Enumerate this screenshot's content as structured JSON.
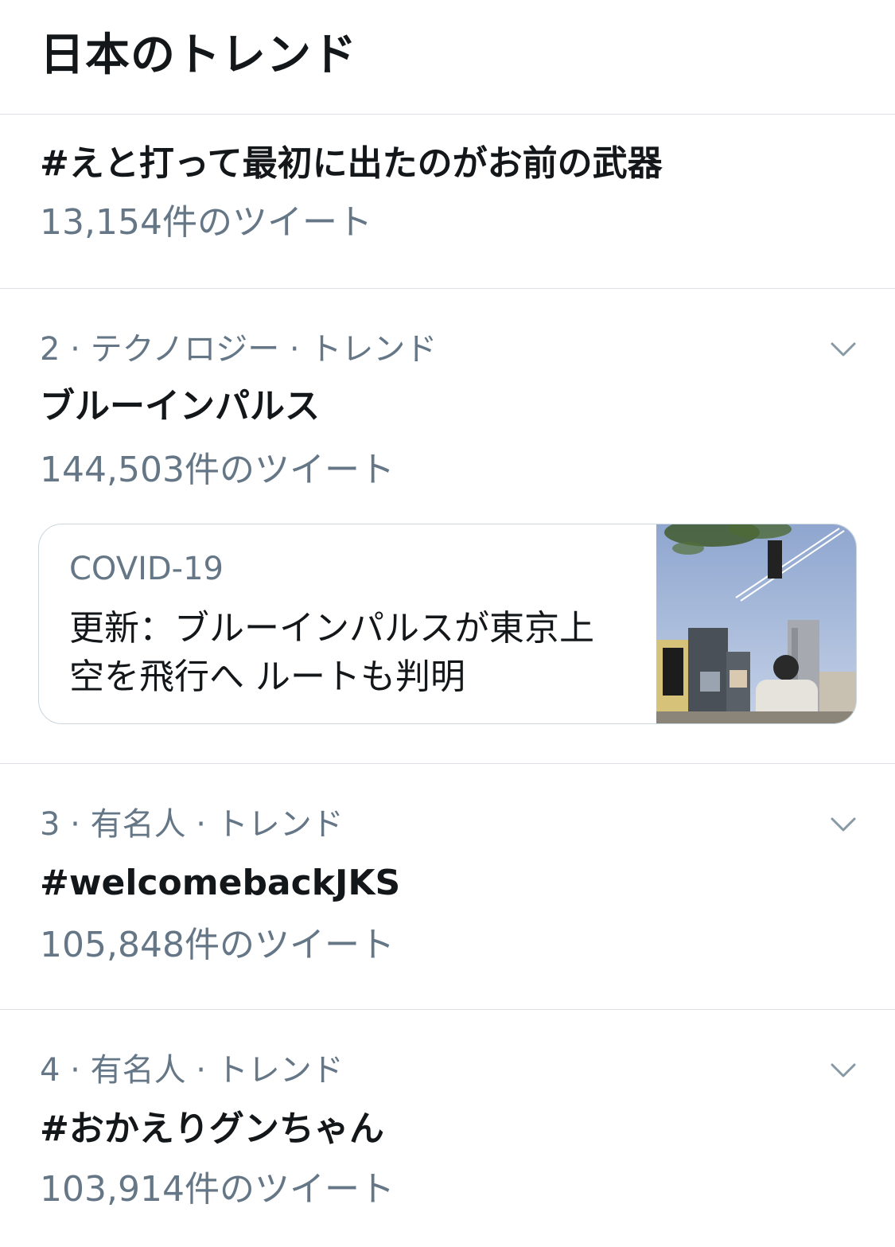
{
  "header": {
    "title": "日本のトレンド"
  },
  "trends": [
    {
      "meta": "",
      "name": "#えと打って最初に出たのがお前の武器",
      "count": "13,154件のツイート"
    },
    {
      "meta": "2 · テクノロジー · トレンド",
      "name": "ブルーインパルス",
      "count": "144,503件のツイート",
      "card": {
        "category": "COVID-19",
        "headline": "更新：ブルーインパルスが東京上空を飛行へ ルートも判明",
        "image_icon": "photo-thumbnail"
      }
    },
    {
      "meta": "3 · 有名人 · トレンド",
      "name": "#welcomebackJKS",
      "count": "105,848件のツイート"
    },
    {
      "meta": "4 · 有名人 · トレンド",
      "name": "#おかえりグンちゃん",
      "count": "103,914件のツイート"
    }
  ],
  "colors": {
    "primary_text": "#14171a",
    "secondary_text": "#657786",
    "divider": "#dde1e5",
    "background": "#ffffff"
  },
  "icons": {
    "more": "chevron-down-icon"
  }
}
